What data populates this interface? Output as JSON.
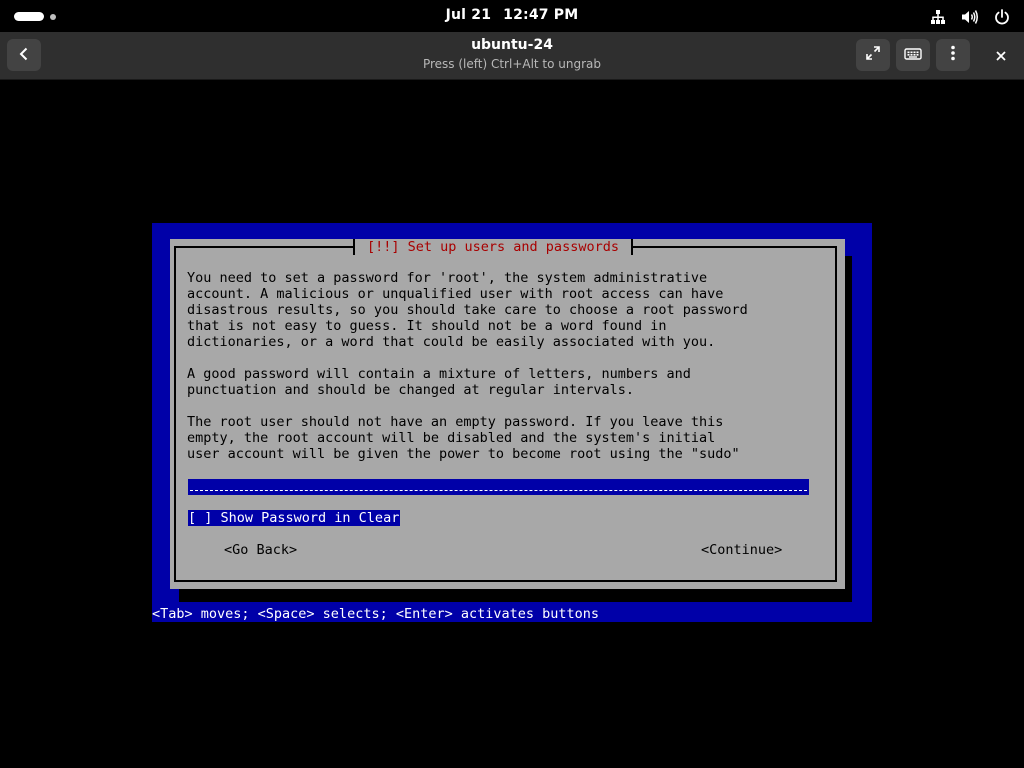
{
  "topbar": {
    "date": "Jul 21",
    "time": "12:47 PM",
    "icons": [
      "activities-indicator",
      "network-wired-icon",
      "volume-icon",
      "power-icon"
    ]
  },
  "window": {
    "title": "ubuntu-24",
    "subtitle": "Press (left) Ctrl+Alt to ungrab",
    "buttons": [
      "back-icon",
      "fullscreen-icon",
      "keyboard-icon",
      "kebab-menu-icon",
      "close-icon"
    ]
  },
  "installer": {
    "dialog_title": "[!!] Set up users and passwords",
    "paragraph_1": "You need to set a password for 'root', the system administrative\naccount. A malicious or unqualified user with root access can have\ndisastrous results, so you should take care to choose a root password\nthat is not easy to guess. It should not be a word found in\ndictionaries, or a word that could be easily associated with you.",
    "paragraph_2": "A good password will contain a mixture of letters, numbers and\npunctuation and should be changed at regular intervals.",
    "paragraph_3": "The root user should not have an empty password. If you leave this\nempty, the root account will be disabled and the system's initial\nuser account will be given the power to become root using the \"sudo\"",
    "password_value": "",
    "show_password_label": "[ ] Show Password in Clear",
    "go_back_label": "<Go Back>",
    "continue_label": "<Continue>",
    "help_line": "<Tab> moves; <Space> selects; <Enter> activates buttons"
  },
  "colors": {
    "console_background": "#000000",
    "installer_blue": "#0000a8",
    "dialog_gray": "#a8a8a8",
    "title_red": "#a80000",
    "headerbar": "#2f2f2f"
  }
}
